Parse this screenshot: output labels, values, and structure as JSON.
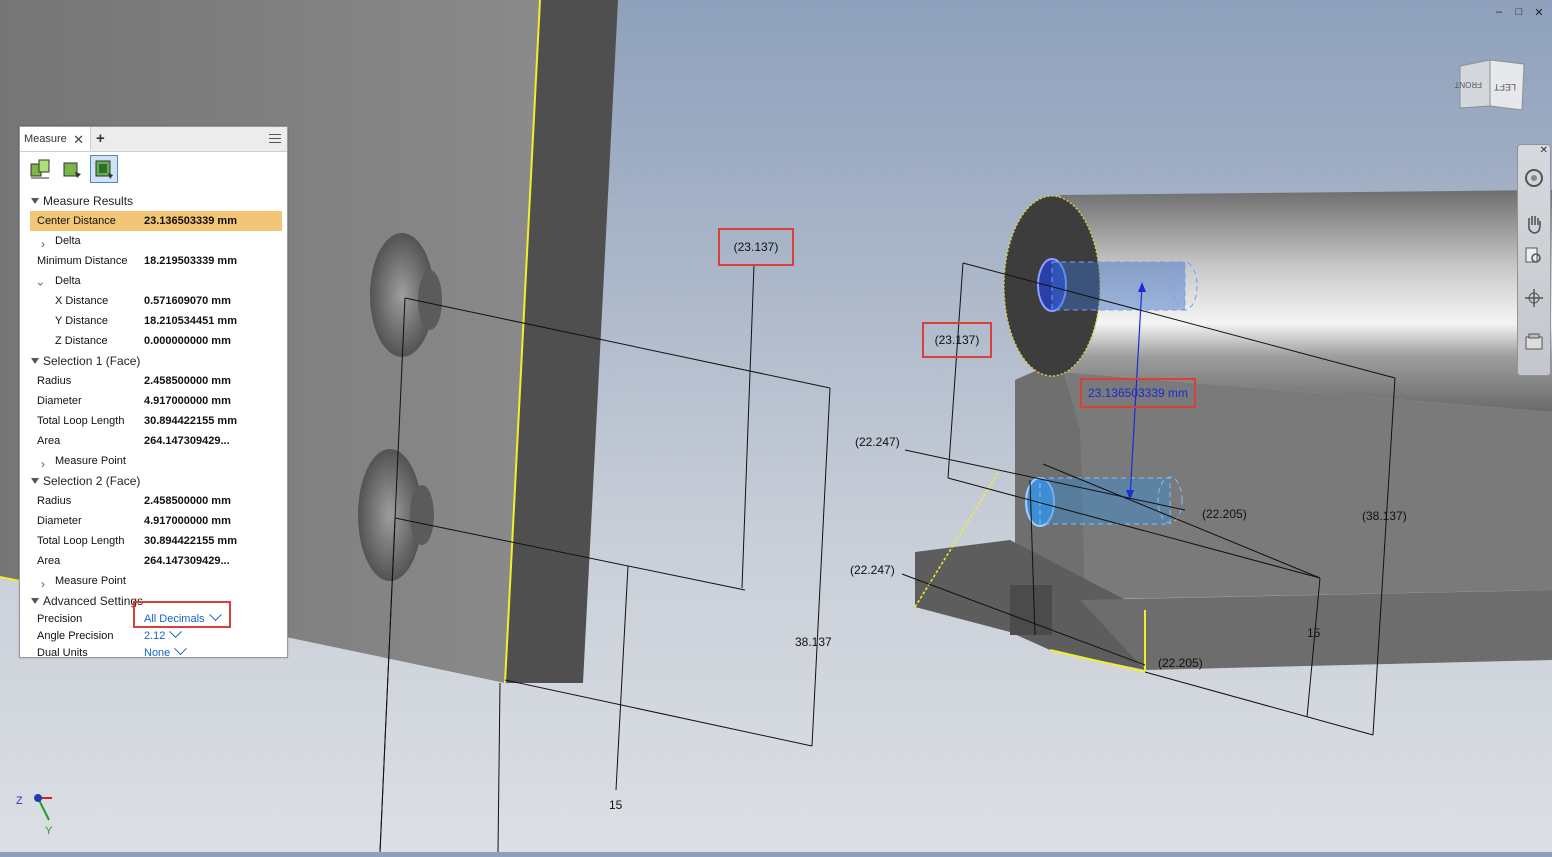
{
  "window_controls": [
    "–",
    "□",
    "✕"
  ],
  "panel": {
    "tab_label": "Measure",
    "tab_close": "✕",
    "tab_add": "+",
    "sections": {
      "results": "Measure Results",
      "sel1": "Selection 1 (Face)",
      "sel2": "Selection 2 (Face)",
      "advanced": "Advanced Settings"
    },
    "results": {
      "center_distance_label": "Center Distance",
      "center_distance_value": "23.136503339 mm",
      "delta_label": "Delta",
      "minimum_distance_label": "Minimum Distance",
      "minimum_distance_value": "18.219503339 mm",
      "delta2_label": "Delta",
      "x_label": "X Distance",
      "x_value": "0.571609070 mm",
      "y_label": "Y Distance",
      "y_value": "18.210534451 mm",
      "z_label": "Z Distance",
      "z_value": "0.000000000 mm"
    },
    "sel1": {
      "radius_label": "Radius",
      "radius_value": "2.458500000 mm",
      "diameter_label": "Diameter",
      "diameter_value": "4.917000000 mm",
      "loop_label": "Total Loop Length",
      "loop_value": "30.894422155 mm",
      "area_label": "Area",
      "area_value": "264.147309429...",
      "measure_point": "Measure Point"
    },
    "sel2": {
      "radius_label": "Radius",
      "radius_value": "2.458500000 mm",
      "diameter_label": "Diameter",
      "diameter_value": "4.917000000 mm",
      "loop_label": "Total Loop Length",
      "loop_value": "30.894422155 mm",
      "area_label": "Area",
      "area_value": "264.147309429...",
      "measure_point": "Measure Point"
    },
    "advanced": {
      "precision_label": "Precision",
      "precision_value": "All Decimals",
      "angle_label": "Angle Precision",
      "angle_value": "2.12",
      "dual_label": "Dual Units",
      "dual_value": "None"
    }
  },
  "dimensions": {
    "d1": "(23.137)",
    "d2": "38.137",
    "d3": "15",
    "d4": "(23.137)",
    "d5": "(22.247)",
    "d6": "(22.247)",
    "d7": "(22.205)",
    "d8": "(22.205)",
    "d9": "(38.137)",
    "d10": "15",
    "measure_value": "23.136503339 mm"
  },
  "viewcube": {
    "face_left": "LEFT",
    "face_front": "FRONT"
  },
  "triad": {
    "z": "Z",
    "y": "Y"
  },
  "colors": {
    "highlight": "#f3c577",
    "annotation_red": "#d9403a",
    "link_blue": "#1565c0",
    "edge_yellow": "#f3ee2a"
  }
}
